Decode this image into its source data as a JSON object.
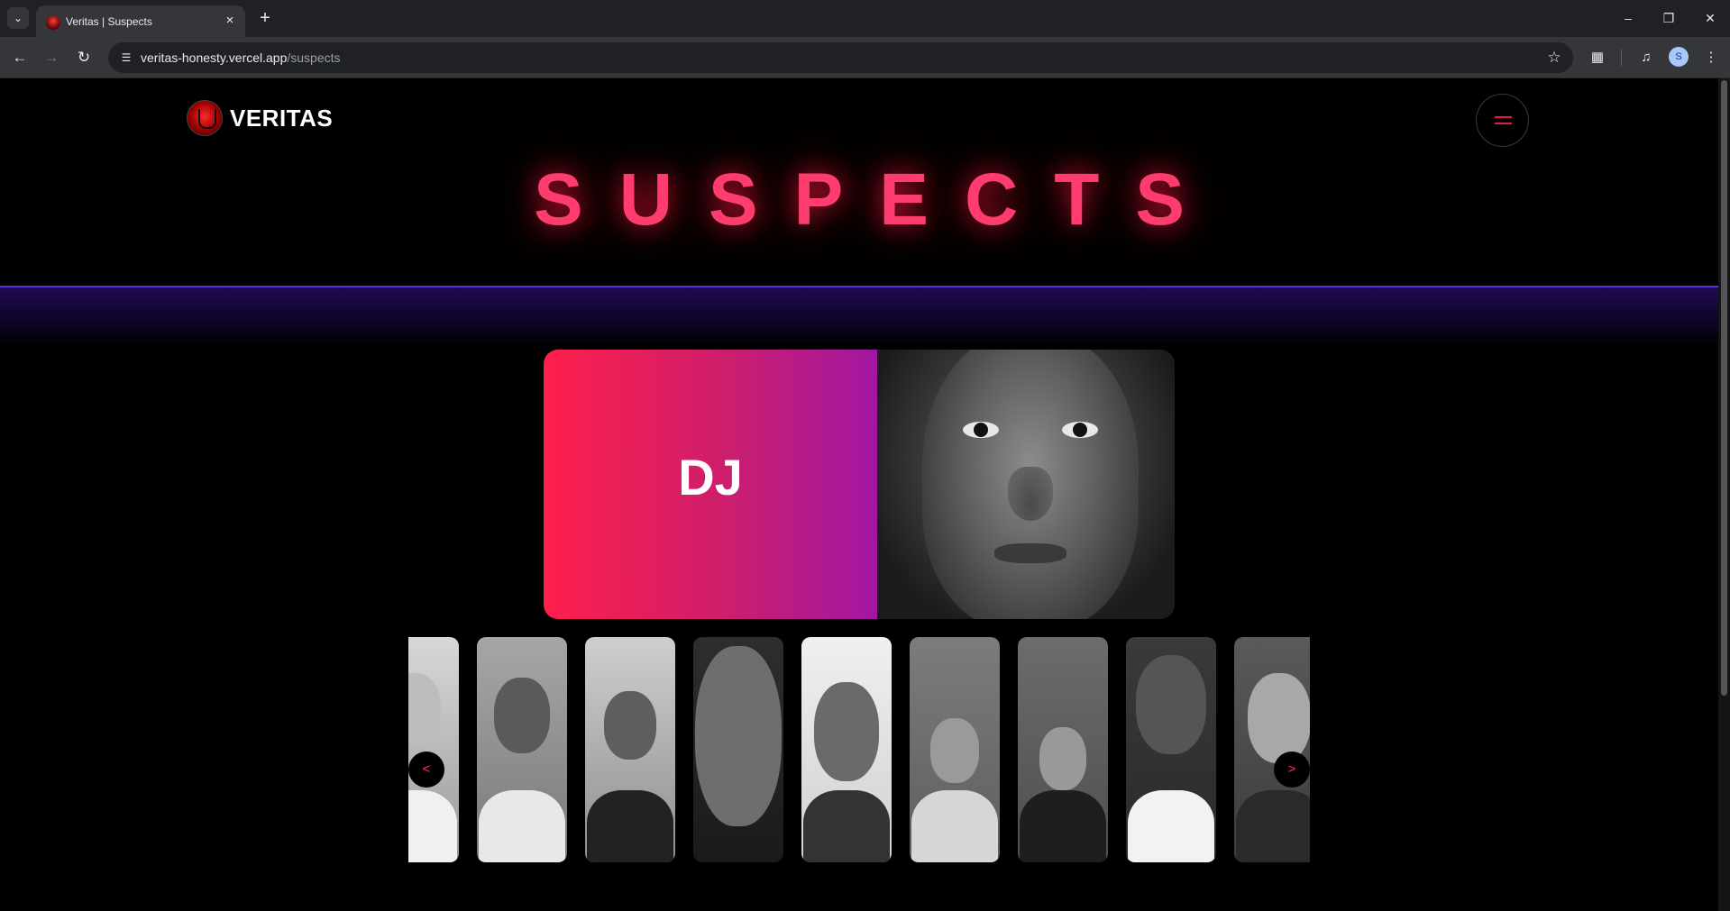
{
  "browser": {
    "tab_title": "Veritas | Suspects",
    "url_host": "veritas-honesty.vercel.app",
    "url_path": "/suspects",
    "profile_initial": "S"
  },
  "site": {
    "logo_text": "VERITAS"
  },
  "page": {
    "title": "SUSPECTS"
  },
  "featured": {
    "name": "DJ"
  },
  "carousel": {
    "prev_label": "<",
    "next_label": ">"
  },
  "colors": {
    "accent": "#ff2e55",
    "title_glow": "#ff1a4a",
    "divider": "#5b2fd6",
    "card_gradient_start": "#ff1f4b",
    "card_gradient_end": "#a117a3"
  }
}
